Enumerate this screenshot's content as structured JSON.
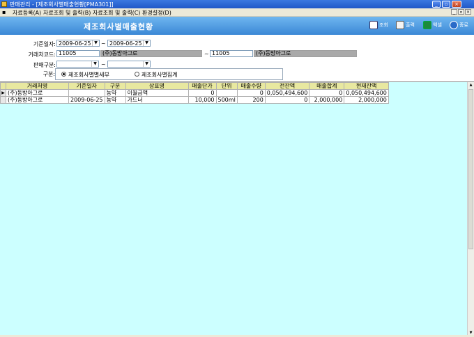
{
  "window": {
    "title": "판매관리 - [제조회사별매출현황[PMA301]]"
  },
  "menu": {
    "items": [
      "자료등록(A)",
      "자료조회 및 출력(B)",
      "자료조회 및 출력(C)",
      "환경설정(D)"
    ]
  },
  "header": {
    "title": "제조회사별매출현황",
    "toolbar": {
      "search": "조회",
      "print": "출력",
      "excel": "엑셀",
      "exit": "종료"
    }
  },
  "filters": {
    "date_label": "기준일자:",
    "date_from": "2009-06-25",
    "date_to": "2009-06-25",
    "tilde": "~",
    "customer_label": "거래처코드:",
    "customer_from_code": "11005",
    "customer_from_name": "(주)동방아그로",
    "customer_to_code": "11005",
    "customer_to_name": "(주)동방아그로",
    "sales_type_label": "판매구분:",
    "sales_type_from": "",
    "sales_type_to": "",
    "division_label": "구분:",
    "radio_detail": "제조회사별별세부",
    "radio_total": "제조회사별집계"
  },
  "grid": {
    "columns": [
      "거래처명",
      "기준일자",
      "구분",
      "상표명",
      "매출단가",
      "단위",
      "매출수량",
      "전잔액",
      "매출합계",
      "현재잔액"
    ],
    "rows": [
      [
        "(주)동방아그로",
        "",
        "농약",
        "이월금액",
        "0",
        "",
        "0",
        "0,050,494,600",
        "0",
        "0,050,494,600"
      ],
      [
        "(주)동방아그로",
        "2009-06-25",
        "농약",
        "가드너",
        "10,000",
        "500ml",
        "200",
        "0",
        "2,000,000",
        "2,000,000"
      ]
    ]
  },
  "colors": {
    "header_blue": "#4a96de",
    "grid_background": "#ccffff",
    "grid_header": "#e8e8a0",
    "readonly_field": "#a9a9a9"
  }
}
